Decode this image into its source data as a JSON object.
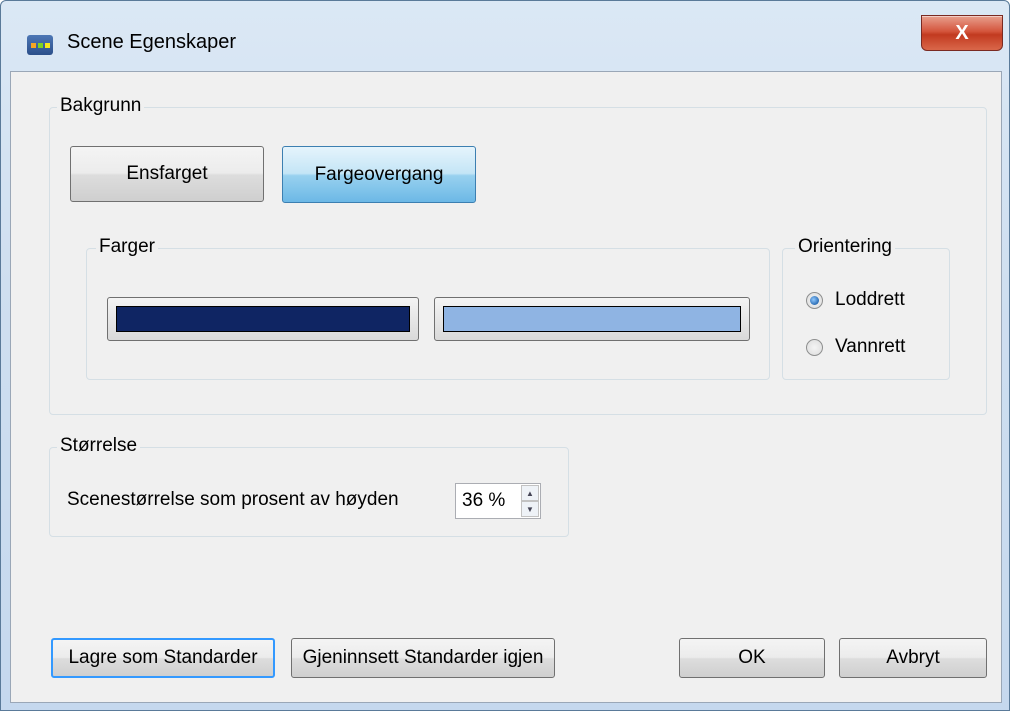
{
  "window": {
    "title": "Scene Egenskaper",
    "close_label": "X"
  },
  "background": {
    "legend": "Bakgrunn",
    "solid_button": "Ensfarget",
    "gradient_button": "Fargeovergang",
    "colors": {
      "legend": "Farger",
      "color1": "#0f2563",
      "color2": "#8fb4e3"
    },
    "orientation": {
      "legend": "Orientering",
      "options": [
        {
          "label": "Loddrett",
          "checked": true
        },
        {
          "label": "Vannrett",
          "checked": false
        }
      ]
    }
  },
  "size": {
    "legend": "Størrelse",
    "label": "Scenestørrelse som prosent av høyden",
    "value": "36 %"
  },
  "footer": {
    "save_defaults": "Lagre som Standarder",
    "restore_defaults": "Gjeninnsett Standarder igjen",
    "ok": "OK",
    "cancel": "Avbryt"
  }
}
